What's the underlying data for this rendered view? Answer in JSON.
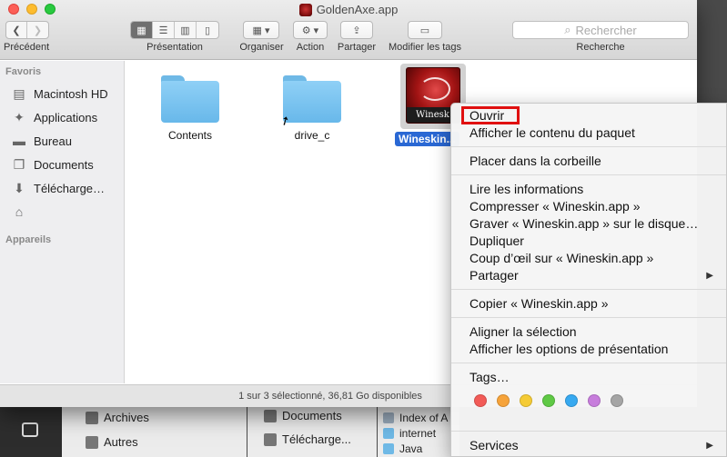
{
  "window": {
    "title": "GoldenAxe.app"
  },
  "toolbar": {
    "back_label": "Précédent",
    "view_label": "Présentation",
    "arrange_label": "Organiser",
    "action_label": "Action",
    "share_label": "Partager",
    "tags_label": "Modifier les tags",
    "search_label": "Recherche",
    "search_placeholder": "Rechercher"
  },
  "sidebar": {
    "favorites_header": "Favoris",
    "items": [
      {
        "label": "Macintosh HD",
        "icon": "hard-drive-icon"
      },
      {
        "label": "Applications",
        "icon": "applications-icon"
      },
      {
        "label": "Bureau",
        "icon": "desktop-icon"
      },
      {
        "label": "Documents",
        "icon": "documents-icon"
      },
      {
        "label": "Télécharge…",
        "icon": "downloads-icon"
      },
      {
        "label": "",
        "icon": "home-icon"
      }
    ],
    "devices_header": "Appareils"
  },
  "content": {
    "items": [
      {
        "name": "Contents",
        "type": "folder"
      },
      {
        "name": "drive_c",
        "type": "folder-alias"
      },
      {
        "name": "Wineskin.app",
        "type": "app",
        "display": "Wineskin..."
      }
    ],
    "icon_badge": "Winesk"
  },
  "status": {
    "text": "1 sur 3 sélectionné, 36,81 Go disponibles"
  },
  "context_menu": {
    "items": [
      "Ouvrir",
      "Afficher le contenu du paquet",
      "Placer dans la corbeille",
      "Lire les informations",
      "Compresser « Wineskin.app »",
      "Graver « Wineskin.app » sur le disque…",
      "Dupliquer",
      "Coup d’œil sur « Wineskin.app »",
      "Partager",
      "Copier « Wineskin.app »",
      "Aligner la sélection",
      "Afficher les options de présentation",
      "Tags…",
      "Services"
    ],
    "tag_colors": [
      "#f25b57",
      "#f6a33a",
      "#f5cb35",
      "#5fc945",
      "#37a9f0",
      "#c77ddc",
      "#a5a5a5"
    ]
  },
  "background": {
    "left_items": [
      "Archives",
      "Autres"
    ],
    "mid_items": [
      "Documents",
      "Télécharge..."
    ],
    "right_items": [
      "Index of A",
      "internet",
      "Java"
    ]
  }
}
